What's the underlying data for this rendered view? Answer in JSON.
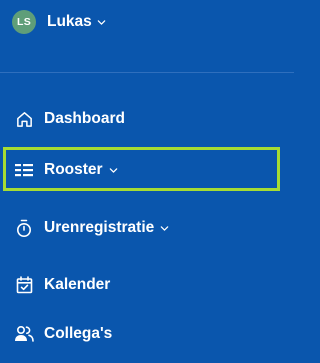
{
  "user": {
    "initials": "LS",
    "name": "Lukas"
  },
  "nav": {
    "items": [
      {
        "label": "Dashboard",
        "icon": "home-icon",
        "has_submenu": false
      },
      {
        "label": "Rooster",
        "icon": "schedule-icon",
        "has_submenu": true,
        "highlighted": true
      },
      {
        "label": "Urenregistratie",
        "icon": "stopwatch-icon",
        "has_submenu": true
      },
      {
        "label": "Kalender",
        "icon": "calendar-check-icon",
        "has_submenu": false
      },
      {
        "label": "Collega's",
        "icon": "users-icon",
        "has_submenu": false
      }
    ]
  },
  "colors": {
    "background": "#0a56ad",
    "avatar": "#5f9e79",
    "highlight_border": "#a6dc34",
    "text": "#ffffff"
  }
}
